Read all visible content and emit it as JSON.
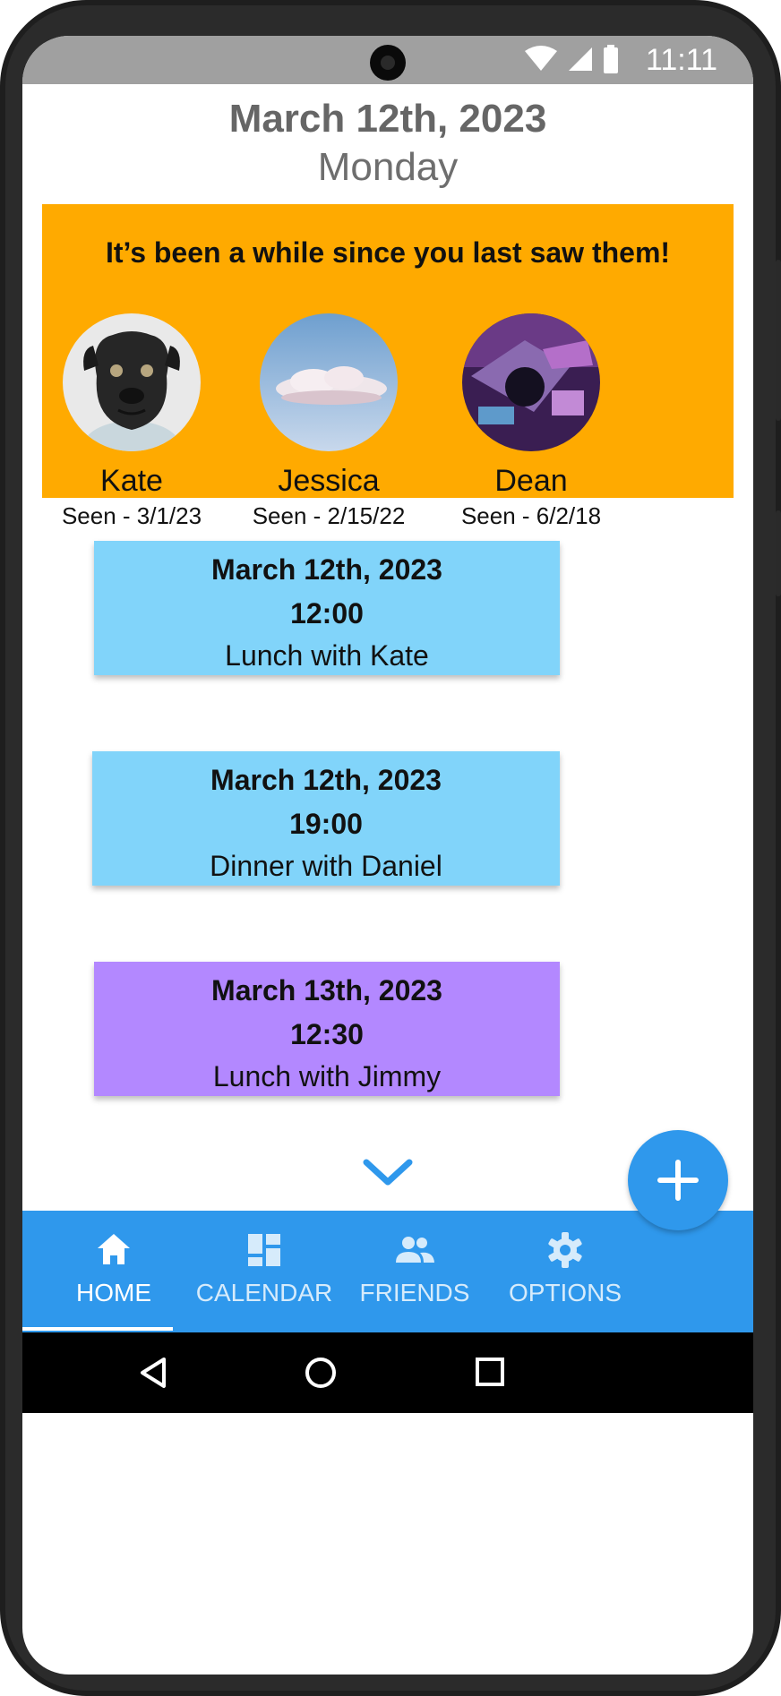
{
  "status": {
    "time": "11:11"
  },
  "header": {
    "date": "March 12th, 2023",
    "day": "Monday"
  },
  "reminder": {
    "title": "It’s been a while since you last saw them!",
    "friends": [
      {
        "name": "Kate",
        "seen": "Seen - 3/1/23",
        "avatar_icon": "pug-photo"
      },
      {
        "name": "Jessica",
        "seen": "Seen - 2/15/22",
        "avatar_icon": "cloud-photo"
      },
      {
        "name": "Dean",
        "seen": "Seen - 6/2/18",
        "avatar_icon": "abstract-photo"
      }
    ],
    "background_color": "#ffaa00"
  },
  "events": [
    {
      "date": "March 12th, 2023",
      "time": "12:00",
      "title": "Lunch with Kate",
      "color": "#81d4fa"
    },
    {
      "date": "March 12th, 2023",
      "time": "19:00",
      "title": "Dinner with Daniel",
      "color": "#81d4fa"
    },
    {
      "date": "March 13th, 2023",
      "time": "12:30",
      "title": "Lunch with Jimmy",
      "color": "#b388ff"
    }
  ],
  "nav": {
    "items": [
      {
        "label": "HOME",
        "icon": "home-icon",
        "active": true
      },
      {
        "label": "CALENDAR",
        "icon": "dashboard-icon",
        "active": false
      },
      {
        "label": "FRIENDS",
        "icon": "people-icon",
        "active": false
      },
      {
        "label": "OPTIONS",
        "icon": "gear-icon",
        "active": false
      }
    ],
    "color": "#2f98ec"
  },
  "colors": {
    "accent": "#2f98ec"
  }
}
